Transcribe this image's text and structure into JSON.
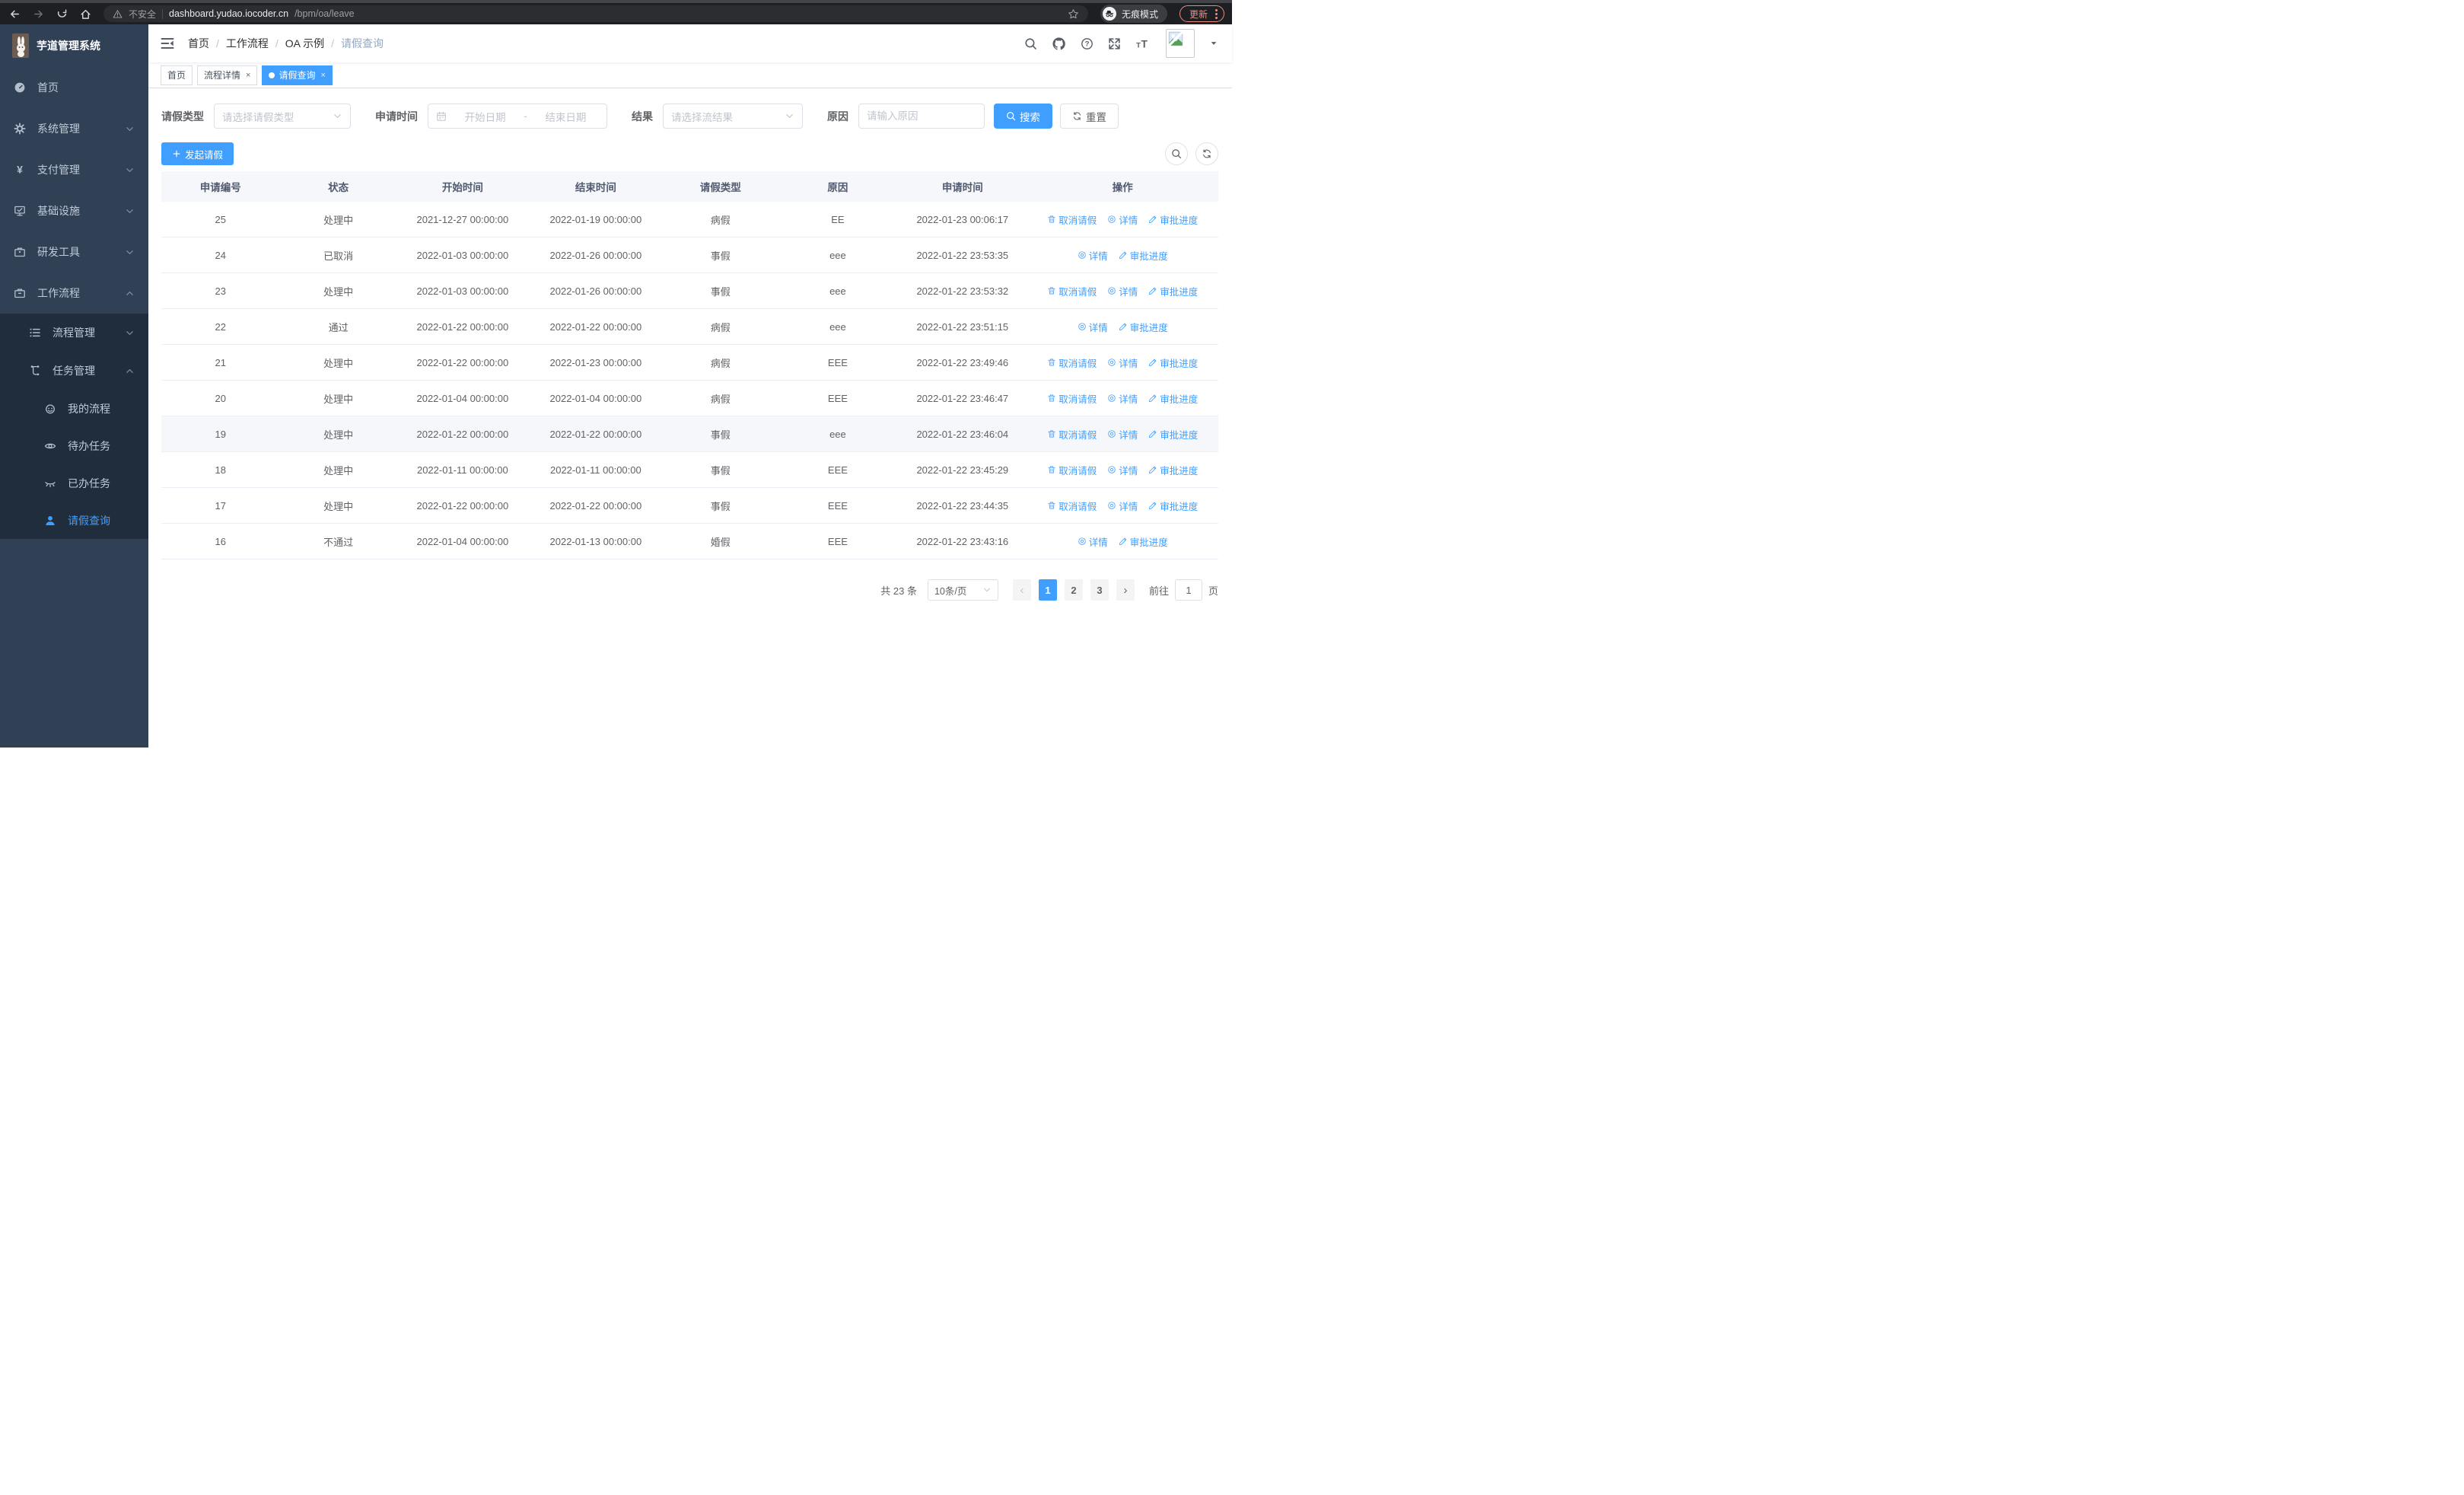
{
  "browser": {
    "security_warning": "不安全",
    "url_host": "dashboard.yudao.iocoder.cn",
    "url_path": "/bpm/oa/leave",
    "incognito_label": "无痕模式",
    "update_label": "更新"
  },
  "sidebar": {
    "app_title": "芋道管理系统",
    "items": [
      {
        "label": "首页",
        "icon": "dashboard",
        "level": 1,
        "chevron": "",
        "submenu": false,
        "active": false
      },
      {
        "label": "系统管理",
        "icon": "gear",
        "level": 1,
        "chevron": "down",
        "submenu": false,
        "active": false
      },
      {
        "label": "支付管理",
        "icon": "yen",
        "level": 1,
        "chevron": "down",
        "submenu": false,
        "active": false
      },
      {
        "label": "基础设施",
        "icon": "monitor",
        "level": 1,
        "chevron": "down",
        "submenu": false,
        "active": false
      },
      {
        "label": "研发工具",
        "icon": "toolbox",
        "level": 1,
        "chevron": "down",
        "submenu": false,
        "active": false
      },
      {
        "label": "工作流程",
        "icon": "briefcase",
        "level": 1,
        "chevron": "up",
        "submenu": false,
        "active": false
      },
      {
        "label": "流程管理",
        "icon": "list",
        "level": 2,
        "chevron": "down",
        "submenu": true,
        "active": false
      },
      {
        "label": "任务管理",
        "icon": "tree",
        "level": 2,
        "chevron": "up",
        "submenu": true,
        "active": false
      },
      {
        "label": "我的流程",
        "icon": "service",
        "level": 3,
        "chevron": "",
        "submenu": true,
        "active": false
      },
      {
        "label": "待办任务",
        "icon": "eyeopen",
        "level": 3,
        "chevron": "",
        "submenu": true,
        "active": false
      },
      {
        "label": "已办任务",
        "icon": "eyeclosed",
        "level": 3,
        "chevron": "",
        "submenu": true,
        "active": false
      },
      {
        "label": "请假查询",
        "icon": "user",
        "level": 3,
        "chevron": "",
        "submenu": true,
        "active": true
      }
    ]
  },
  "header": {
    "breadcrumb": [
      "首页",
      "工作流程",
      "OA 示例",
      "请假查询"
    ]
  },
  "tabs": [
    {
      "label": "首页",
      "closable": false,
      "active": false
    },
    {
      "label": "流程详情",
      "closable": true,
      "active": false
    },
    {
      "label": "请假查询",
      "closable": true,
      "active": true
    }
  ],
  "filters": {
    "leave_type_label": "请假类型",
    "leave_type_placeholder": "请选择请假类型",
    "apply_time_label": "申请时间",
    "date_start_placeholder": "开始日期",
    "date_separator": "-",
    "date_end_placeholder": "结束日期",
    "result_label": "结果",
    "result_placeholder": "请选择流结果",
    "reason_label": "原因",
    "reason_placeholder": "请输入原因",
    "search_label": "搜索",
    "reset_label": "重置"
  },
  "toolbar": {
    "create_label": "发起请假"
  },
  "table": {
    "columns": [
      "申请编号",
      "状态",
      "开始时间",
      "结束时间",
      "请假类型",
      "原因",
      "申请时间",
      "操作"
    ],
    "actions": {
      "cancel": "取消请假",
      "detail": "详情",
      "progress": "审批进度"
    },
    "rows": [
      {
        "id": "25",
        "status": "处理中",
        "start": "2021-12-27 00:00:00",
        "end": "2022-01-19 00:00:00",
        "type": "病假",
        "reason": "EE",
        "apply": "2022-01-23 00:06:17",
        "cancellable": true,
        "highlighted": false
      },
      {
        "id": "24",
        "status": "已取消",
        "start": "2022-01-03 00:00:00",
        "end": "2022-01-26 00:00:00",
        "type": "事假",
        "reason": "eee",
        "apply": "2022-01-22 23:53:35",
        "cancellable": false,
        "highlighted": false
      },
      {
        "id": "23",
        "status": "处理中",
        "start": "2022-01-03 00:00:00",
        "end": "2022-01-26 00:00:00",
        "type": "事假",
        "reason": "eee",
        "apply": "2022-01-22 23:53:32",
        "cancellable": true,
        "highlighted": false
      },
      {
        "id": "22",
        "status": "通过",
        "start": "2022-01-22 00:00:00",
        "end": "2022-01-22 00:00:00",
        "type": "病假",
        "reason": "eee",
        "apply": "2022-01-22 23:51:15",
        "cancellable": false,
        "highlighted": false
      },
      {
        "id": "21",
        "status": "处理中",
        "start": "2022-01-22 00:00:00",
        "end": "2022-01-23 00:00:00",
        "type": "病假",
        "reason": "EEE",
        "apply": "2022-01-22 23:49:46",
        "cancellable": true,
        "highlighted": false
      },
      {
        "id": "20",
        "status": "处理中",
        "start": "2022-01-04 00:00:00",
        "end": "2022-01-04 00:00:00",
        "type": "病假",
        "reason": "EEE",
        "apply": "2022-01-22 23:46:47",
        "cancellable": true,
        "highlighted": false
      },
      {
        "id": "19",
        "status": "处理中",
        "start": "2022-01-22 00:00:00",
        "end": "2022-01-22 00:00:00",
        "type": "事假",
        "reason": "eee",
        "apply": "2022-01-22 23:46:04",
        "cancellable": true,
        "highlighted": true
      },
      {
        "id": "18",
        "status": "处理中",
        "start": "2022-01-11 00:00:00",
        "end": "2022-01-11 00:00:00",
        "type": "事假",
        "reason": "EEE",
        "apply": "2022-01-22 23:45:29",
        "cancellable": true,
        "highlighted": false
      },
      {
        "id": "17",
        "status": "处理中",
        "start": "2022-01-22 00:00:00",
        "end": "2022-01-22 00:00:00",
        "type": "事假",
        "reason": "EEE",
        "apply": "2022-01-22 23:44:35",
        "cancellable": true,
        "highlighted": false
      },
      {
        "id": "16",
        "status": "不通过",
        "start": "2022-01-04 00:00:00",
        "end": "2022-01-13 00:00:00",
        "type": "婚假",
        "reason": "EEE",
        "apply": "2022-01-22 23:43:16",
        "cancellable": false,
        "highlighted": false
      }
    ]
  },
  "pagination": {
    "total_label": "共 23 条",
    "page_size_label": "10条/页",
    "pages": [
      "1",
      "2",
      "3"
    ],
    "active_page": "1",
    "prev_symbol": "‹",
    "next_symbol": "›",
    "goto_label": "前往",
    "goto_value": "1",
    "page_suffix": "页"
  },
  "colors": {
    "accent": "#409eff",
    "sidebar_bg": "#304156",
    "submenu_bg": "#1f2d3d",
    "update_badge": "#f28b82"
  }
}
